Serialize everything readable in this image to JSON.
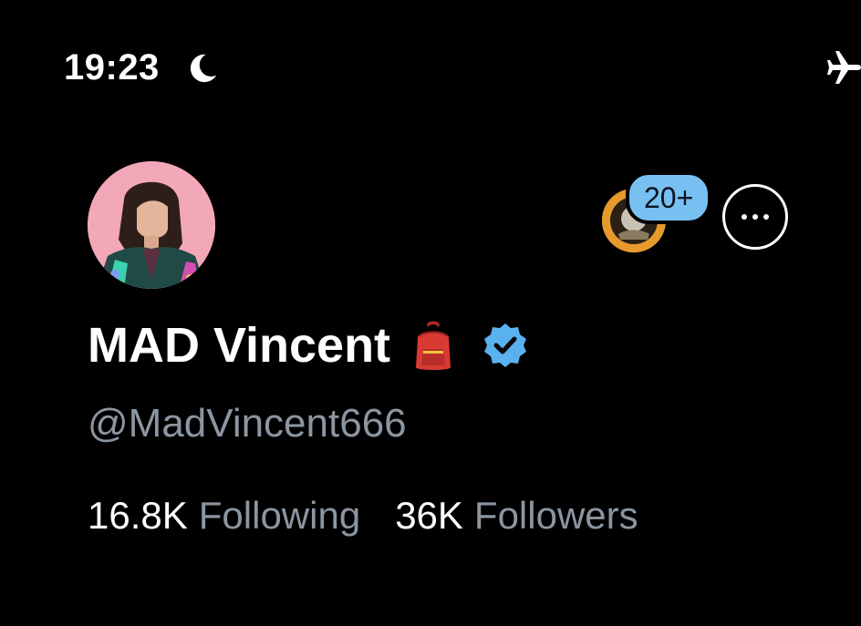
{
  "status_bar": {
    "time": "19:23",
    "focus_icon": "moon-icon",
    "connectivity_icon": "airplane-icon"
  },
  "profile": {
    "display_name": "MAD Vincent",
    "name_emoji": "backpack-icon",
    "verified_icon": "verified-badge-icon",
    "handle": "@MadVincent666",
    "following_count": "16.8K",
    "following_label": "Following",
    "followers_count": "36K",
    "followers_label": "Followers"
  },
  "header_actions": {
    "followed_by_badge": "20+",
    "more_icon": "more-options-icon"
  },
  "colors": {
    "background": "#000000",
    "text_primary": "#ffffff",
    "text_secondary": "#8c96a1",
    "verified_blue": "#5ab1f0",
    "badge_blue": "#79c0f2"
  }
}
